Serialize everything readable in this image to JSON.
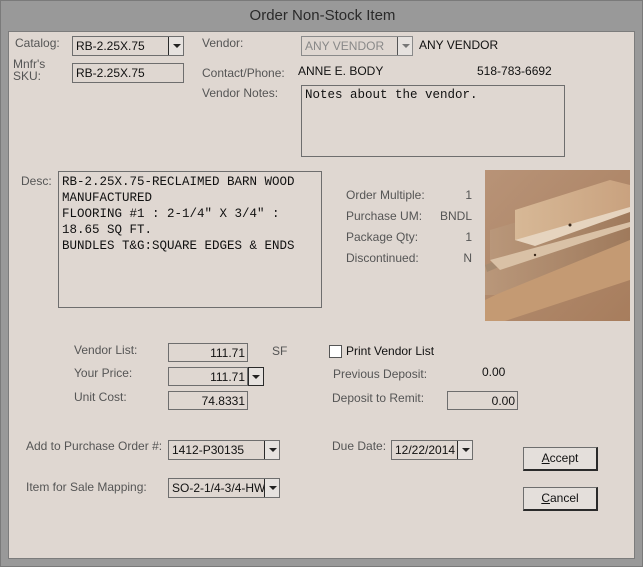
{
  "window": {
    "title": "Order Non-Stock Item"
  },
  "catalog": {
    "label": "Catalog:",
    "value": "RB-2.25X.75"
  },
  "sku": {
    "label": "Mnfr's\nSKU:",
    "label_line1": "Mnfr's",
    "label_line2": "SKU:",
    "value": "RB-2.25X.75"
  },
  "vendor": {
    "label": "Vendor:",
    "value": "ANY VENDOR",
    "name": "ANY VENDOR",
    "contact_label": "Contact/Phone:",
    "contact_name": "ANNE E. BODY",
    "phone": "518-783-6692",
    "notes_label": "Vendor Notes:",
    "notes": "Notes about the vendor."
  },
  "description": {
    "label": "Desc:",
    "text": "RB-2.25X.75-RECLAIMED BARN WOOD\nMANUFACTURED\nFLOORING #1 : 2-1/4\" X 3/4\" :\n18.65 SQ FT.\nBUNDLES T&G:SQUARE EDGES & ENDS"
  },
  "item_info": {
    "order_multiple_label": "Order Multiple:",
    "order_multiple": "1",
    "purchase_um_label": "Purchase UM:",
    "purchase_um": "BNDL",
    "package_qty_label": "Package Qty:",
    "package_qty": "1",
    "discontinued_label": "Discontinued:",
    "discontinued": "N",
    "image_icon": "wood-flooring-photo"
  },
  "pricing": {
    "vendor_list_label": "Vendor List:",
    "vendor_list": "111.71",
    "unit": "SF",
    "your_price_label": "Your Price:",
    "your_price": "111.71",
    "unit_cost_label": "Unit Cost:",
    "unit_cost": "74.8331",
    "print_vendor_list_label": "Print Vendor List",
    "print_vendor_list_checked": false,
    "previous_deposit_label": "Previous Deposit:",
    "previous_deposit": "0.00",
    "deposit_to_remit_label": "Deposit to Remit:",
    "deposit_to_remit": "0.00"
  },
  "order": {
    "po_label": "Add to Purchase Order #:",
    "po_value": "1412-P30135",
    "mapping_label": "Item for Sale Mapping:",
    "mapping_value": "SO-2-1/4-3/4-HW",
    "due_date_label": "Due Date:",
    "due_date": "12/22/2014"
  },
  "buttons": {
    "accept": "Accept",
    "accept_mnemonic": "A",
    "accept_rest": "ccept",
    "cancel": "Cancel",
    "cancel_mnemonic": "C",
    "cancel_rest": "ancel"
  }
}
